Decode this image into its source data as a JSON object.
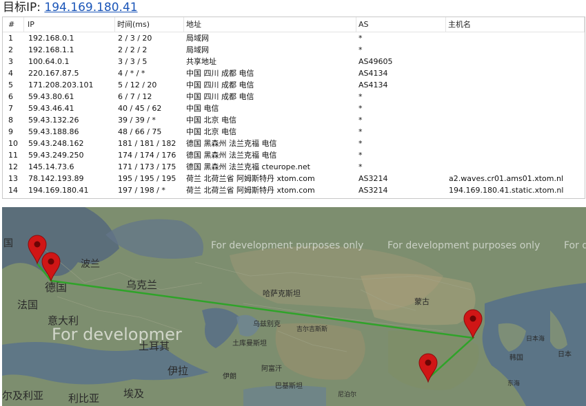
{
  "target": {
    "label": "目标IP:",
    "ip": "194.169.180.41"
  },
  "table": {
    "headers": [
      "#",
      "IP",
      "时间(ms)",
      "地址",
      "AS",
      "主机名"
    ],
    "rows": [
      [
        "1",
        "192.168.0.1",
        "2 / 3 / 20",
        "局域网",
        "*",
        ""
      ],
      [
        "2",
        "192.168.1.1",
        "2 / 2 / 2",
        "局域网",
        "*",
        ""
      ],
      [
        "3",
        "100.64.0.1",
        "3 / 3 / 5",
        "共享地址",
        "AS49605",
        ""
      ],
      [
        "4",
        "220.167.87.5",
        "4 / * / *",
        "中国 四川 成都 电信",
        "AS4134",
        ""
      ],
      [
        "5",
        "171.208.203.101",
        "5 / 12 / 20",
        "中国 四川 成都 电信",
        "AS4134",
        ""
      ],
      [
        "6",
        "59.43.80.61",
        "6 / 7 / 12",
        "中国 四川 成都 电信",
        "*",
        ""
      ],
      [
        "7",
        "59.43.46.41",
        "40 / 45 / 62",
        "中国 电信",
        "*",
        ""
      ],
      [
        "8",
        "59.43.132.26",
        "39 / 39 / *",
        "中国 北京 电信",
        "*",
        ""
      ],
      [
        "9",
        "59.43.188.86",
        "48 / 66 / 75",
        "中国 北京 电信",
        "*",
        ""
      ],
      [
        "10",
        "59.43.248.162",
        "181 / 181 / 182",
        "德国 黑森州 法兰克福 电信",
        "*",
        ""
      ],
      [
        "11",
        "59.43.249.250",
        "174 / 174 / 176",
        "德国 黑森州 法兰克福 电信",
        "*",
        ""
      ],
      [
        "12",
        "145.14.73.6",
        "171 / 173 / 175",
        "德国 黑森州 法兰克福 cteurope.net",
        "*",
        ""
      ],
      [
        "13",
        "78.142.193.89",
        "195 / 195 / 195",
        "荷兰 北荷兰省 阿姆斯特丹 xtom.com",
        "AS3214",
        "a2.waves.cr01.ams01.xtom.nl"
      ],
      [
        "14",
        "194.169.180.41",
        "197 / 198 / *",
        "荷兰 北荷兰省 阿姆斯特丹 xtom.com",
        "AS3214",
        "194.169.180.41.static.xtom.nl"
      ]
    ]
  },
  "map": {
    "watermark": "For development purposes only",
    "watermark_large": "For developmer",
    "watermark_edge": "For d",
    "labels": {
      "england": "国",
      "poland": "波兰",
      "germany": "德国",
      "ukraine": "乌克兰",
      "france": "法国",
      "italy": "意大利",
      "turkey": "土耳其",
      "kazakhstan": "哈萨克斯坦",
      "mongolia": "蒙古",
      "uzbekistan": "乌兹别克",
      "kyrgyzstan": "吉尔吉斯斯",
      "turkmenistan": "土库曼斯坦",
      "iran": "伊朗",
      "iraq": "伊拉",
      "afghanistan": "阿富汗",
      "pakistan": "巴基斯坦",
      "nepal": "尼泊尔",
      "sea_of_japan": "日本海",
      "japan": "日本",
      "korea": "韩国",
      "east_sea": "东海",
      "algeria": "尔及利亚",
      "libya": "利比亚",
      "egypt": "埃及"
    },
    "colors": {
      "route": "#2fa329",
      "marker": "#d01616"
    }
  }
}
